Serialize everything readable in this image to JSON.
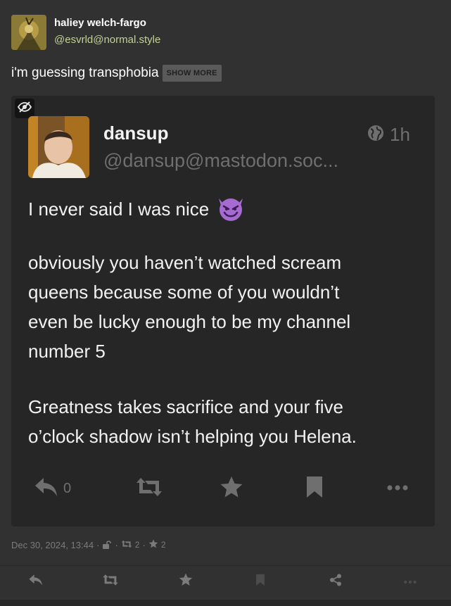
{
  "colors": {
    "background": "#313131",
    "media_background": "#262626",
    "handle_accent": "#c1d395",
    "muted": "#7b7b7b"
  },
  "post": {
    "author_name": "haliey welch-fargo",
    "author_handle": "@esvrld@normal.style",
    "avatar_icon": "avatar-image",
    "content": "i'm guessing transphobia",
    "show_more_label": "SHOW MORE"
  },
  "media": {
    "hide_icon": "eye-slash-icon",
    "embedded_post": {
      "name": "dansup",
      "handle": "@dansup@mastodon.soc...",
      "globe_icon": "globe-icon",
      "time": "1h",
      "lines": [
        "I never said I was nice",
        "obviously you haven’t watched scream",
        "queens because some of you wouldn’t",
        "even be lucky enough to be my channel",
        "number 5",
        "Greatness takes sacrifice and your five",
        "o’clock shadow isn’t helping you Helena."
      ],
      "emoji": "smiling-devil-emoji",
      "reply_count": "0"
    }
  },
  "meta": {
    "timestamp": "Dec 30, 2024, 13:44",
    "separator": "·",
    "visibility_icon": "unlock-icon",
    "boost_count": "2",
    "favourite_count": "2"
  },
  "actions": {
    "reply": "reply-icon",
    "boost": "boost-icon",
    "favourite": "star-icon",
    "bookmark": "bookmark-icon",
    "share": "share-icon",
    "more": "more-icon"
  }
}
